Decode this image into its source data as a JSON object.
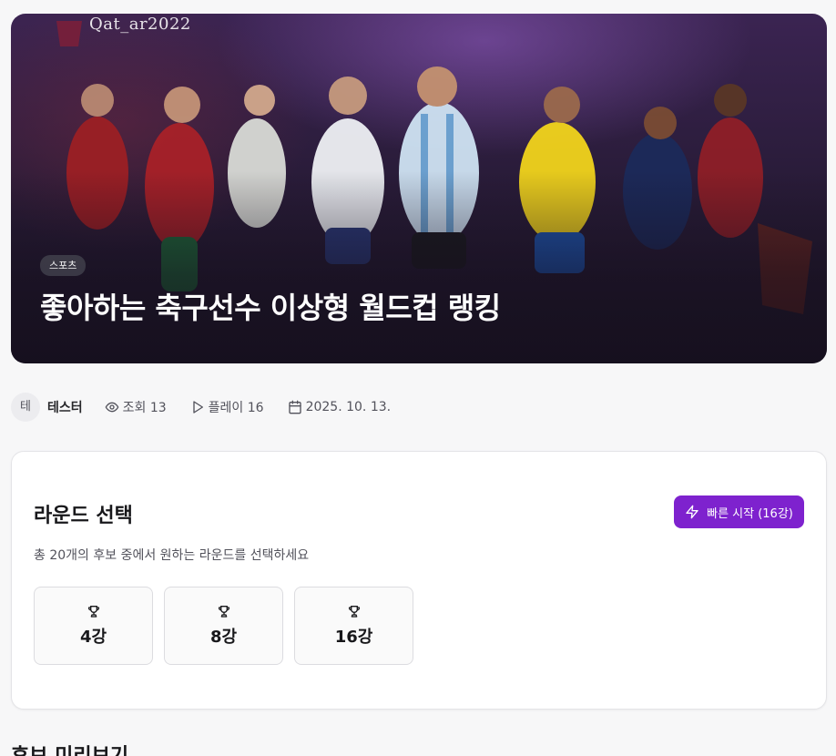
{
  "hero": {
    "brand_text": "Qat_ar2022",
    "category_badge": "스포츠",
    "title": "좋아하는 축구선수 이상형 월드컵 랭킹"
  },
  "meta": {
    "avatar_initial": "테",
    "author": "테스터",
    "views": "조회 13",
    "plays": "플레이 16",
    "date": "2025. 10. 13."
  },
  "round_select": {
    "heading": "라운드 선택",
    "description": "총 20개의 후보 중에서 원하는 라운드를 선택하세요",
    "quick_start_label": "빠른 시작 (16강)",
    "rounds": [
      {
        "label": "4강"
      },
      {
        "label": "8강"
      },
      {
        "label": "16강"
      }
    ]
  },
  "preview": {
    "heading": "후보 미리보기"
  },
  "colors": {
    "accent": "#7e22ce",
    "background": "#f7f7f8"
  },
  "icons": {
    "views": "eye-icon",
    "plays": "play-icon",
    "date": "calendar-icon",
    "quick_start": "lightning-icon",
    "round": "trophy-icon"
  }
}
